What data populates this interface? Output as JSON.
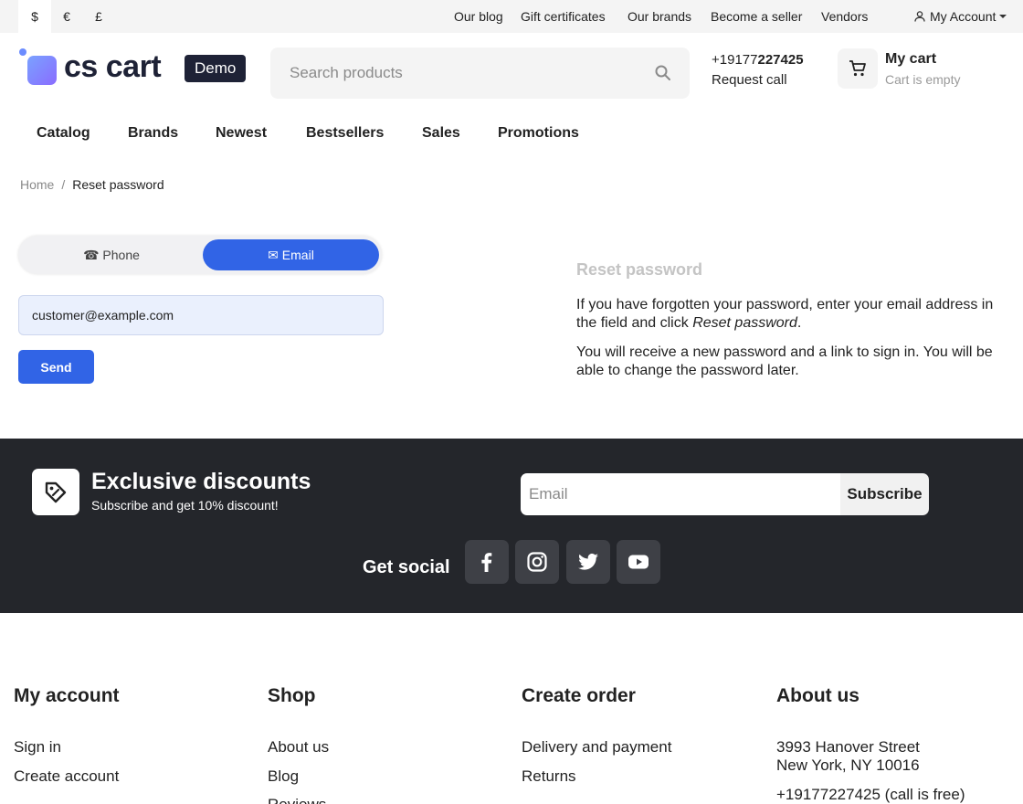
{
  "topbar": {
    "currencies": [
      "$",
      "€",
      "£"
    ],
    "active_currency": "$",
    "links": [
      "Our blog",
      "Gift certificates",
      "Our brands",
      "Become a seller",
      "Vendors"
    ],
    "account_label": "My Account"
  },
  "header": {
    "logo_text": "cs cart",
    "demo_badge": "Demo",
    "search_placeholder": "Search products",
    "phone_prefix": "+19177",
    "phone_bold": "227425",
    "request_call": "Request call",
    "cart_title": "My cart",
    "cart_status": "Cart is empty"
  },
  "nav": [
    "Catalog",
    "Brands",
    "Newest",
    "Bestsellers",
    "Sales",
    "Promotions"
  ],
  "breadcrumb": {
    "home": "Home",
    "sep": "/",
    "current": "Reset password"
  },
  "reset_form": {
    "tab_phone": "☎ Phone",
    "tab_email": "✉ Email",
    "active_tab": "email",
    "email_value": "customer@example.com",
    "send_label": "Send"
  },
  "info": {
    "title": "Reset password",
    "p1_before": "If you have forgotten your password, enter your email address in the field and click ",
    "p1_em": "Reset password",
    "p1_after": ".",
    "p2": "You will receive a new password and a link to sign in. You will be able to change the password later."
  },
  "newsletter": {
    "title": "Exclusive discounts",
    "subtitle": "Subscribe and get 10% discount!",
    "email_placeholder": "Email",
    "subscribe_label": "Subscribe",
    "social_label": "Get social"
  },
  "footer": {
    "columns": [
      {
        "title": "My account",
        "links": [
          "Sign in",
          "Create account"
        ]
      },
      {
        "title": "Shop",
        "links": [
          "About us",
          "Blog",
          "Reviews"
        ]
      },
      {
        "title": "Create order",
        "links": [
          "Delivery and payment",
          "Returns"
        ]
      },
      {
        "title": "About us",
        "lines": [
          "3993 Hanover Street",
          "New York, NY 10016",
          "+19177227425 (call is free)"
        ]
      }
    ]
  },
  "colors": {
    "accent": "#3164e6",
    "band": "#24262b",
    "logo": "#1e2236"
  }
}
